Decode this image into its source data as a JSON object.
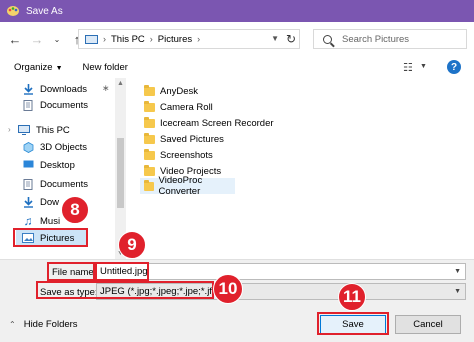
{
  "window": {
    "title": "Save As"
  },
  "address": {
    "crumbs": [
      "This PC",
      "Pictures"
    ]
  },
  "search": {
    "placeholder": "Search Pictures"
  },
  "toolbar": {
    "organize_label": "Organize",
    "new_folder_label": "New folder",
    "help": "?"
  },
  "navpane": {
    "items": [
      {
        "label": "Downloads",
        "icon": "download-arrow-icon",
        "pinned": true
      },
      {
        "label": "Documents",
        "icon": "document-icon",
        "pinned": false
      },
      {
        "label": "This PC",
        "icon": "computer-icon",
        "pinned": false
      },
      {
        "label": "3D Objects",
        "icon": "cube-icon",
        "pinned": false
      },
      {
        "label": "Desktop",
        "icon": "desktop-icon",
        "pinned": false
      },
      {
        "label": "Documents",
        "icon": "document-icon",
        "pinned": false
      },
      {
        "label": "Dow",
        "icon": "download-arrow-icon",
        "pinned": false
      },
      {
        "label": "Musi",
        "icon": "music-note-icon",
        "pinned": false
      },
      {
        "label": "Pictures",
        "icon": "pictures-icon",
        "pinned": false,
        "selected": true
      }
    ]
  },
  "files": [
    {
      "name": "AnyDesk"
    },
    {
      "name": "Camera Roll"
    },
    {
      "name": "Icecream Screen Recorder"
    },
    {
      "name": "Saved Pictures"
    },
    {
      "name": "Screenshots"
    },
    {
      "name": "Video Projects"
    },
    {
      "name": "VideoProc Converter",
      "selected": true
    }
  ],
  "form": {
    "file_name_label": "File name:",
    "file_name_value": "Untitled.jpg",
    "save_type_label": "Save as type:",
    "save_type_value": "JPEG (*.jpg;*.jpeg;*.jpe;*.jfif)"
  },
  "footer": {
    "hide_folders_label": "Hide Folders",
    "save_label": "Save",
    "cancel_label": "Cancel"
  },
  "annotations": {
    "badges": [
      "8",
      "9",
      "10",
      "11"
    ],
    "color": "#e0212c"
  },
  "colors": {
    "titlebar": "#7b56b1",
    "accent": "#0078d7",
    "folder": "#f6c84c"
  }
}
